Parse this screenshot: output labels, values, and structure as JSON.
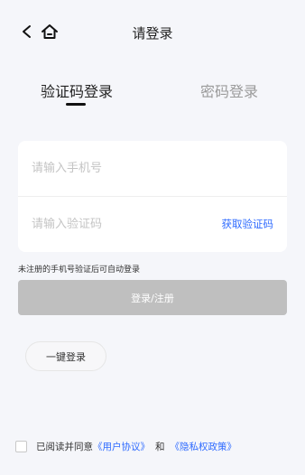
{
  "header": {
    "title": "请登录",
    "back_icon": "chevron-left-icon",
    "home_icon": "home-icon"
  },
  "tabs": [
    {
      "label": "验证码登录",
      "active": true
    },
    {
      "label": "密码登录",
      "active": false
    }
  ],
  "form": {
    "phone_placeholder": "请输入手机号",
    "code_placeholder": "请输入验证码",
    "get_code_label": "获取验证码"
  },
  "notice": "未注册的手机号验证后可自动登录",
  "login_button": "登录/注册",
  "one_key_button": "一键登录",
  "agreement": {
    "prefix": "已阅读并同意",
    "user_agreement": "《用户协议》",
    "and": "和",
    "privacy_policy": "《隐私权政策》"
  },
  "colors": {
    "accent": "#2f6bff",
    "disabled_button": "#bfbfbf",
    "background": "#f5f6fa"
  }
}
